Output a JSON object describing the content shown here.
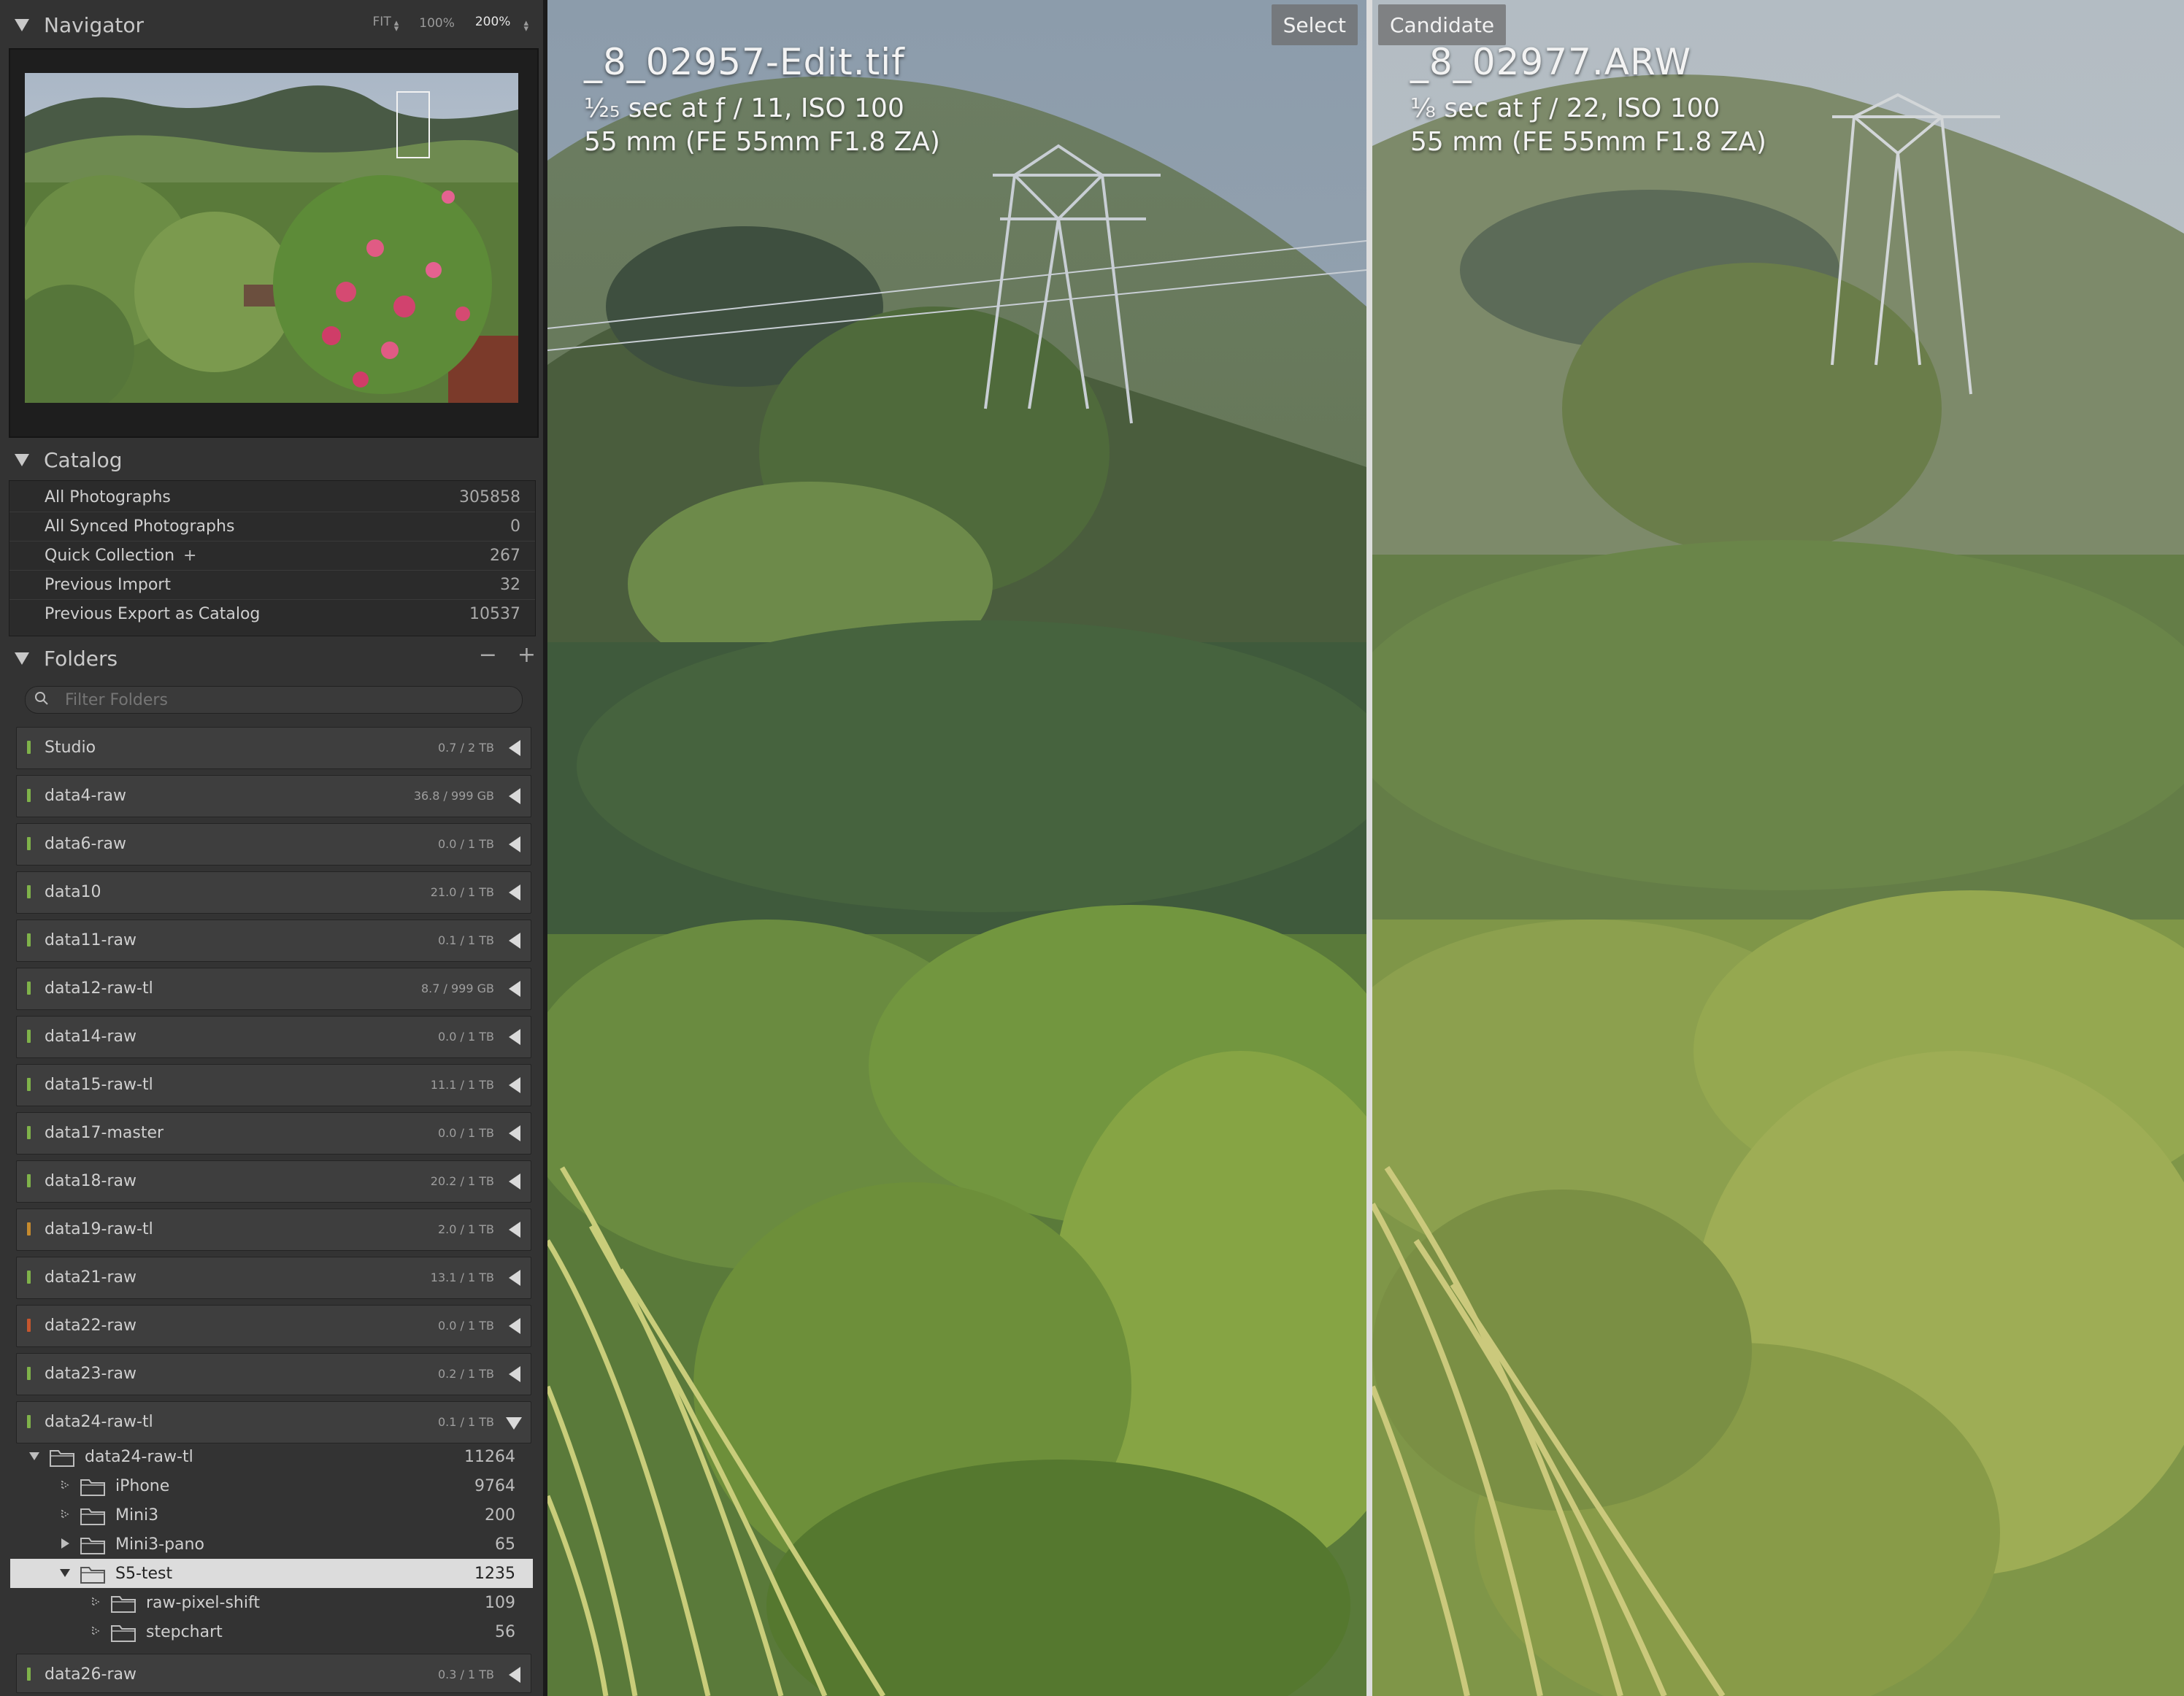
{
  "navigator": {
    "title": "Navigator",
    "zoom": [
      "FIT",
      "100%",
      "200%"
    ]
  },
  "catalog": {
    "title": "Catalog",
    "items": [
      {
        "label": "All Photographs",
        "count": "305858"
      },
      {
        "label": "All Synced Photographs",
        "count": "0"
      },
      {
        "label": "Quick Collection",
        "count": "267",
        "plus": "+"
      },
      {
        "label": "Previous Import",
        "count": "32"
      },
      {
        "label": "Previous Export as Catalog",
        "count": "10537"
      }
    ]
  },
  "folders": {
    "title": "Folders",
    "minus": "−",
    "plus": "+",
    "filter_placeholder": "Filter Folders",
    "volumes": [
      {
        "name": "Studio",
        "cap": "0.7 / 2 TB",
        "led": "#7fb24a"
      },
      {
        "name": "data4-raw",
        "cap": "36.8 / 999 GB",
        "led": "#7fb24a"
      },
      {
        "name": "data6-raw",
        "cap": "0.0 / 1 TB",
        "led": "#7fb24a"
      },
      {
        "name": "data10",
        "cap": "21.0 / 1 TB",
        "led": "#7fb24a"
      },
      {
        "name": "data11-raw",
        "cap": "0.1 / 1 TB",
        "led": "#7fb24a"
      },
      {
        "name": "data12-raw-tl",
        "cap": "8.7 / 999 GB",
        "led": "#7fb24a"
      },
      {
        "name": "data14-raw",
        "cap": "0.0 / 1 TB",
        "led": "#7fb24a"
      },
      {
        "name": "data15-raw-tl",
        "cap": "11.1 / 1 TB",
        "led": "#7fb24a"
      },
      {
        "name": "data17-master",
        "cap": "0.0 / 1 TB",
        "led": "#7fb24a"
      },
      {
        "name": "data18-raw",
        "cap": "20.2 / 1 TB",
        "led": "#7fb24a"
      },
      {
        "name": "data19-raw-tl",
        "cap": "2.0 / 1 TB",
        "led": "#c58a2e"
      },
      {
        "name": "data21-raw",
        "cap": "13.1 / 1 TB",
        "led": "#7fb24a"
      },
      {
        "name": "data22-raw",
        "cap": "0.0 / 1 TB",
        "led": "#c5562e"
      },
      {
        "name": "data23-raw",
        "cap": "0.2 / 1 TB",
        "led": "#7fb24a"
      },
      {
        "name": "data24-raw-tl",
        "cap": "0.1 / 1 TB",
        "led": "#7fb24a",
        "expanded": true
      }
    ],
    "tree": [
      {
        "name": "data24-raw-tl",
        "count": "11264",
        "level": 0,
        "exp": "open"
      },
      {
        "name": "iPhone",
        "count": "9764",
        "level": 1,
        "exp": "dot"
      },
      {
        "name": "Mini3",
        "count": "200",
        "level": 1,
        "exp": "dot"
      },
      {
        "name": "Mini3-pano",
        "count": "65",
        "level": 1,
        "exp": "closed"
      },
      {
        "name": "S5-test",
        "count": "1235",
        "level": 1,
        "exp": "open",
        "active": true
      },
      {
        "name": "raw-pixel-shift",
        "count": "109",
        "level": 2,
        "exp": "dot"
      },
      {
        "name": "stepchart",
        "count": "56",
        "level": 2,
        "exp": "dot"
      }
    ],
    "last_volume": {
      "name": "data26-raw",
      "cap": "0.3 / 1 TB",
      "led": "#7fb24a"
    }
  },
  "select": {
    "tag": "Select",
    "filename": "_8_02957-Edit.tif",
    "exposure": "⅟₂₅ sec at ƒ / 11, ISO 100",
    "lens": "55 mm (FE 55mm F1.8 ZA)"
  },
  "candidate": {
    "tag": "Candidate",
    "filename": "_8_02977.ARW",
    "exposure": "⅛ sec at ƒ / 22, ISO 100",
    "lens": "55 mm (FE 55mm F1.8 ZA)"
  }
}
